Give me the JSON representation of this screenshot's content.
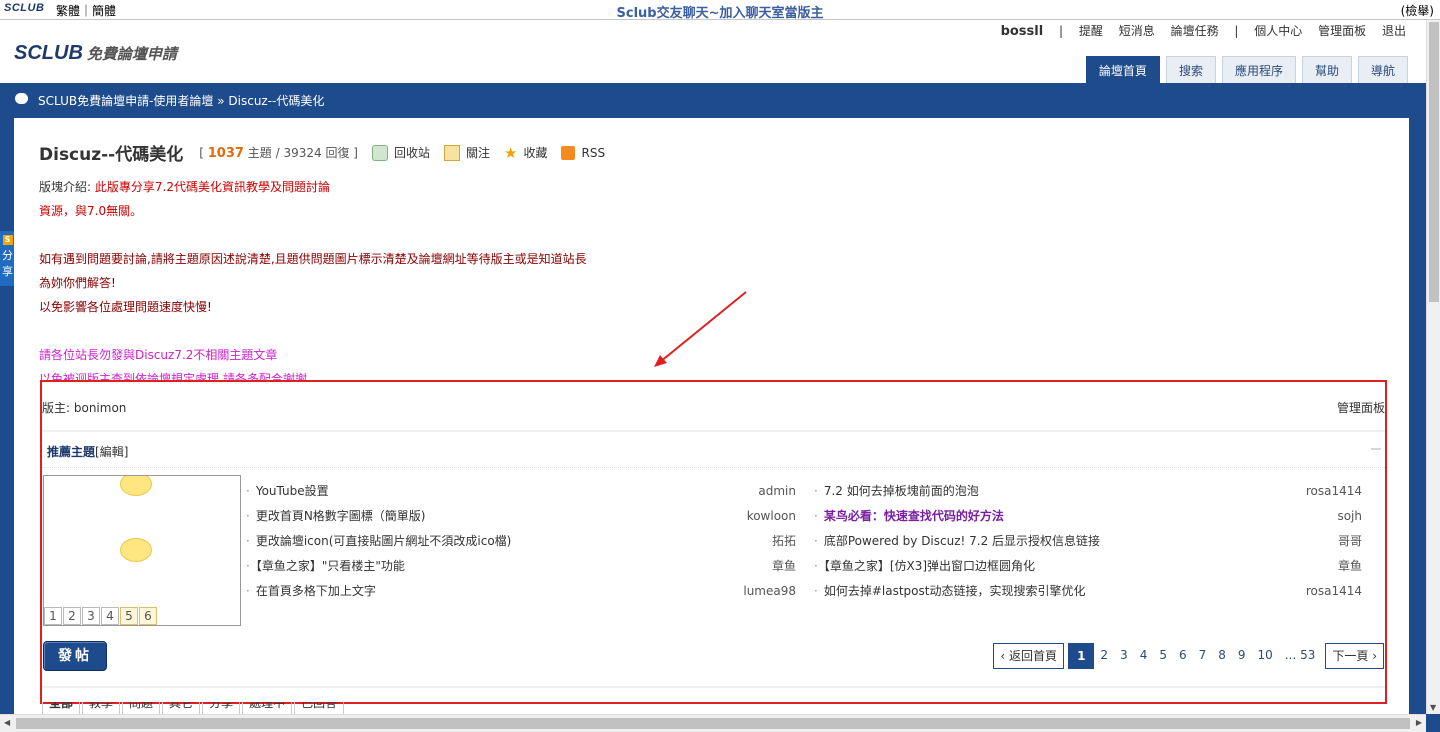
{
  "topbar": {
    "logo_small": "SCLUB",
    "lang": "繁體｜簡體",
    "site_title": "Sclub交友聊天~加入聊天室當版主",
    "report": "(檢舉)"
  },
  "header": {
    "logo_text": "SCLUB",
    "logo_sub": "免費論壇申請",
    "user": "bossll",
    "nav": [
      "提醒",
      "短消息",
      "論壇任務",
      "個人中心",
      "管理面板",
      "退出"
    ],
    "tabs": [
      "論壇首頁",
      "搜索",
      "應用程序",
      "幫助",
      "導航"
    ]
  },
  "breadcrumb": "SCLUB免費論壇申請-使用者論壇 » Discuz--代碼美化",
  "sidetab": {
    "icon": "S",
    "label": "分享"
  },
  "forum": {
    "name": "Discuz--代碼美化",
    "threads": "1037",
    "threads_unit": "主題 /",
    "replies": "39324",
    "replies_unit": "回復 ]",
    "open_bracket": "[",
    "actions": [
      "回收站",
      "關注",
      "收藏",
      "RSS"
    ]
  },
  "intro": {
    "label": "版塊介紹:",
    "line1": "此版專分享7.2代碼美化資訊教學及問題討論",
    "line2": "資源，與7.0無關。",
    "line3": "如有遇到問題要討論,請將主題原因述說清楚,且題供問題圖片標示清楚及論壇網址等待版主或是知道站長",
    "line4": "為妳你們解答!",
    "line5": "以免影響各位處理問題速度快慢!",
    "line6": "請各位站長勿發與Discuz7.2不相關主題文章",
    "line7": "以免被迴版主查到依論壇規定處理,請各多配合謝謝"
  },
  "moderator": "版主: bonimon",
  "manage_panel": "管理面板",
  "recommend": {
    "title": "推薦主題",
    "edit": "[編輯]",
    "slide_pages": [
      "1",
      "2",
      "3",
      "4",
      "5",
      "6"
    ],
    "left": [
      {
        "title": "YouTube設置",
        "author": "admin"
      },
      {
        "title": "更改首頁N格數字圖標（簡單版)",
        "author": "kowloon"
      },
      {
        "title": "更改論壇icon(可直接貼圖片網址不須改成ico檔)",
        "author": "拓拓"
      },
      {
        "title": "【章鱼之家】\"只看楼主\"功能",
        "author": "章鱼"
      },
      {
        "title": "在首頁多格下加上文字",
        "author": "lumea98"
      }
    ],
    "right": [
      {
        "title": "7.2 如何去掉板塊前面的泡泡",
        "author": "rosa1414"
      },
      {
        "title": "某鸟必看：快速查找代码的好方法",
        "author": "sojh"
      },
      {
        "title": "底部Powered by Discuz! 7.2 后显示授权信息链接",
        "author": "哥哥"
      },
      {
        "title": "【章鱼之家】[仿X3]弹出窗口边框圆角化",
        "author": "章鱼"
      },
      {
        "title": "如何去掉#lastpost动态链接，实现搜索引擎优化",
        "author": "rosa1414"
      }
    ]
  },
  "post_button": "發帖",
  "pager": {
    "back": "返回首頁",
    "pages": [
      "1",
      "2",
      "3",
      "4",
      "5",
      "6",
      "7",
      "8",
      "9",
      "10",
      "... 53"
    ],
    "next": "下一頁"
  },
  "type_tabs": [
    "全部",
    "教學",
    "問題",
    "其它",
    "分享",
    "處理中",
    "已回答"
  ],
  "colors": {
    "accent": "#1e4b8c",
    "annotation": "#e02020",
    "highlight_title": "#7a1fa2"
  }
}
